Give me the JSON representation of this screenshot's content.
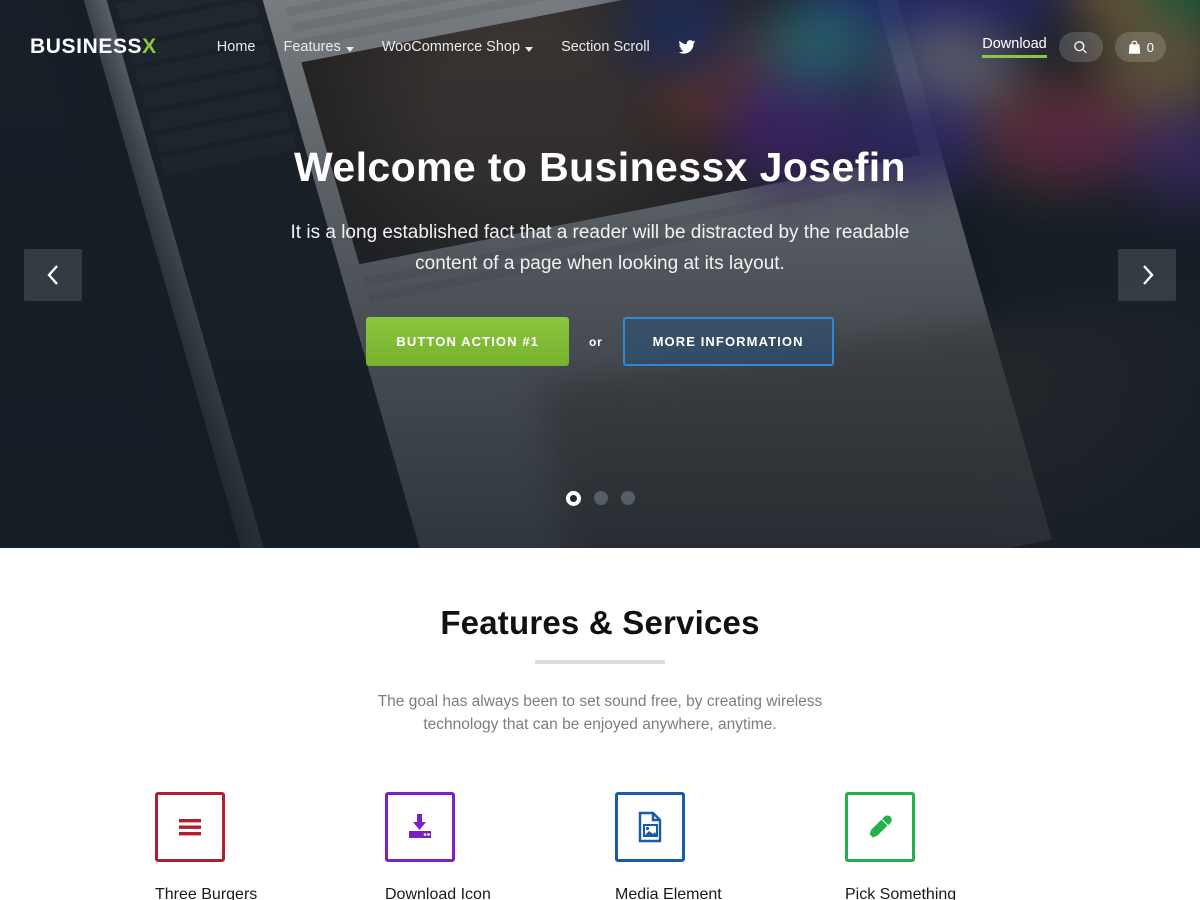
{
  "site": {
    "logo_text": "BUSINESS",
    "logo_accent": "X",
    "accent_green": "#8dc63f"
  },
  "nav": {
    "items": [
      {
        "label": "Home",
        "has_caret": false
      },
      {
        "label": "Features",
        "has_caret": true
      },
      {
        "label": "WooCommerce Shop",
        "has_caret": true
      },
      {
        "label": "Section Scroll",
        "has_caret": false
      }
    ],
    "social_icon": "twitter-icon"
  },
  "header_right": {
    "download_label": "Download",
    "search_icon": "search-icon",
    "cart_icon": "shopping-bag-icon",
    "cart_count": "0"
  },
  "hero": {
    "title": "Welcome to Businessx Josefin",
    "subtitle": "It is a long established fact that a reader will be distracted by the readable content of a page when looking at its layout.",
    "primary_button": "Button Action #1",
    "or_text": "or",
    "secondary_button": "More Information",
    "prev_icon": "chevron-left-icon",
    "next_icon": "chevron-right-icon",
    "slides": [
      {
        "active": true
      },
      {
        "active": false
      },
      {
        "active": false
      }
    ]
  },
  "features": {
    "title": "Features & Services",
    "subtitle": "The goal has always been to set sound free, by creating wireless technology that can be enjoyed anywhere, anytime.",
    "items": [
      {
        "label": "Three Burgers",
        "icon": "hamburger-menu-icon",
        "color": "#b11f2f"
      },
      {
        "label": "Download Icon",
        "icon": "download-drive-icon",
        "color": "#7b20c4"
      },
      {
        "label": "Media Element",
        "icon": "image-document-icon",
        "color": "#1a5ba8"
      },
      {
        "label": "Pick Something",
        "icon": "eyedropper-icon",
        "color": "#22b14c"
      }
    ]
  }
}
